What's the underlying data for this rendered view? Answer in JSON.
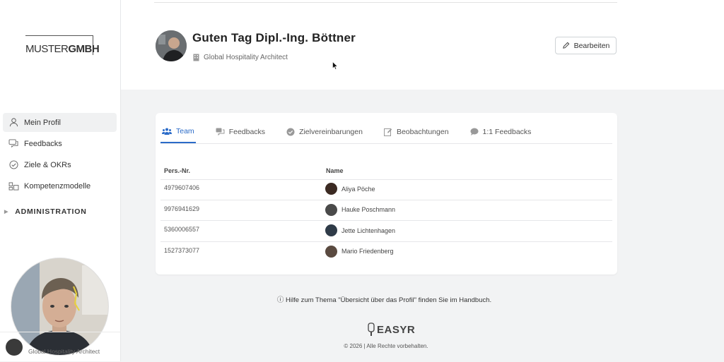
{
  "brand": {
    "logo_light": "MUSTER",
    "logo_bold": "GMBH"
  },
  "sidebar": {
    "items": [
      {
        "label": "Mein Profil",
        "icon": "user-icon",
        "active": true
      },
      {
        "label": "Feedbacks",
        "icon": "chat-bubbles-icon"
      },
      {
        "label": "Ziele & OKRs",
        "icon": "check-circle-icon"
      },
      {
        "label": "Kompetenzmodelle",
        "icon": "model-grid-icon"
      }
    ],
    "section": "ADMINISTRATION",
    "footer_role": "Global Hospitality Architect"
  },
  "header": {
    "greeting": "Guten Tag Dipl.-Ing. Böttner",
    "role": "Global Hospitality Architect",
    "edit_label": "Bearbeiten"
  },
  "tabs": [
    {
      "label": "Team",
      "icon": "team-icon",
      "active": true
    },
    {
      "label": "Feedbacks",
      "icon": "feedback-icon"
    },
    {
      "label": "Zielvereinbarungen",
      "icon": "check-circle-icon"
    },
    {
      "label": "Beobachtungen",
      "icon": "edit-note-icon"
    },
    {
      "label": "1:1 Feedbacks",
      "icon": "comment-icon"
    }
  ],
  "table": {
    "headers": [
      "Pers.-Nr.",
      "Name"
    ],
    "rows": [
      {
        "id": "4979607406",
        "name": "Aliya Pöche"
      },
      {
        "id": "9976941629",
        "name": "Hauke Poschmann"
      },
      {
        "id": "5360006557",
        "name": "Jette Lichtenhagen"
      },
      {
        "id": "1527373077",
        "name": "Mario Friedenberg"
      }
    ]
  },
  "help_text": "Hilfe zum Thema \"Übersicht über das Profil\" finden Sie im Handbuch.",
  "footer": {
    "brand": "EASYR",
    "copyright": "© 2026 | Alle Rechte vorbehalten."
  },
  "colors": {
    "accent": "#2b6bc8",
    "background": "#f2f3f4"
  }
}
